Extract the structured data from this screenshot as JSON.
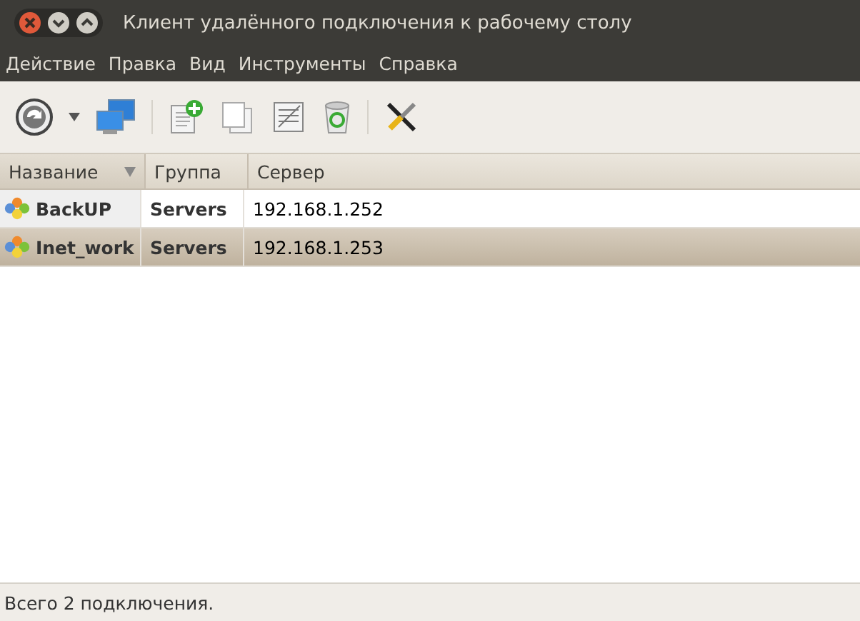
{
  "window": {
    "title": "Клиент удалённого подключения к рабочему столу"
  },
  "menu": [
    "Действие",
    "Правка",
    "Вид",
    "Инструменты",
    "Справка"
  ],
  "table": {
    "columns": [
      {
        "label": "Название",
        "sorted": true
      },
      {
        "label": "Группа",
        "sorted": false
      },
      {
        "label": "Сервер",
        "sorted": false
      }
    ],
    "rows": [
      {
        "name": "BackUP",
        "group": "Servers",
        "server": "192.168.1.252",
        "selected": false
      },
      {
        "name": "Inet_work",
        "group": "Servers",
        "server": "192.168.1.253",
        "selected": true
      }
    ]
  },
  "status_bar": "Всего 2 подключения."
}
